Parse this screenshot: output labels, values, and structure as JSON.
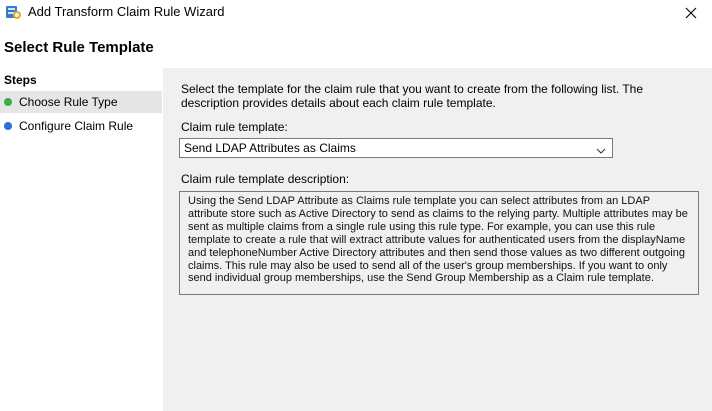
{
  "window": {
    "title": "Add Transform Claim Rule Wizard",
    "icon": "wizard-server-icon"
  },
  "page_title": "Select Rule Template",
  "sidebar": {
    "header": "Steps",
    "items": [
      {
        "label": "Choose Rule Type",
        "status_color": "#3cb043",
        "active": true
      },
      {
        "label": "Configure Claim Rule",
        "status_color": "#2a6fdb",
        "active": false
      }
    ]
  },
  "main": {
    "intro": "Select the template for the claim rule that you want to create from the following list. The description provides details about each claim rule template.",
    "template_label": "Claim rule template:",
    "template_value": "Send LDAP Attributes as Claims",
    "description_label": "Claim rule template description:",
    "description_text": "Using the Send LDAP Attribute as Claims rule template you can select attributes from an LDAP attribute store such as Active Directory to send as claims to the relying party. Multiple attributes may be sent as multiple claims from a single rule using this rule type. For example, you can use this rule template to create a rule that will extract attribute values for authenticated users from the displayName and telephoneNumber Active Directory attributes and then send those values as two different outgoing claims. This rule may also be used to send all of the user's group memberships. If you want to only send individual group memberships, use the Send Group Membership as a Claim rule template."
  }
}
